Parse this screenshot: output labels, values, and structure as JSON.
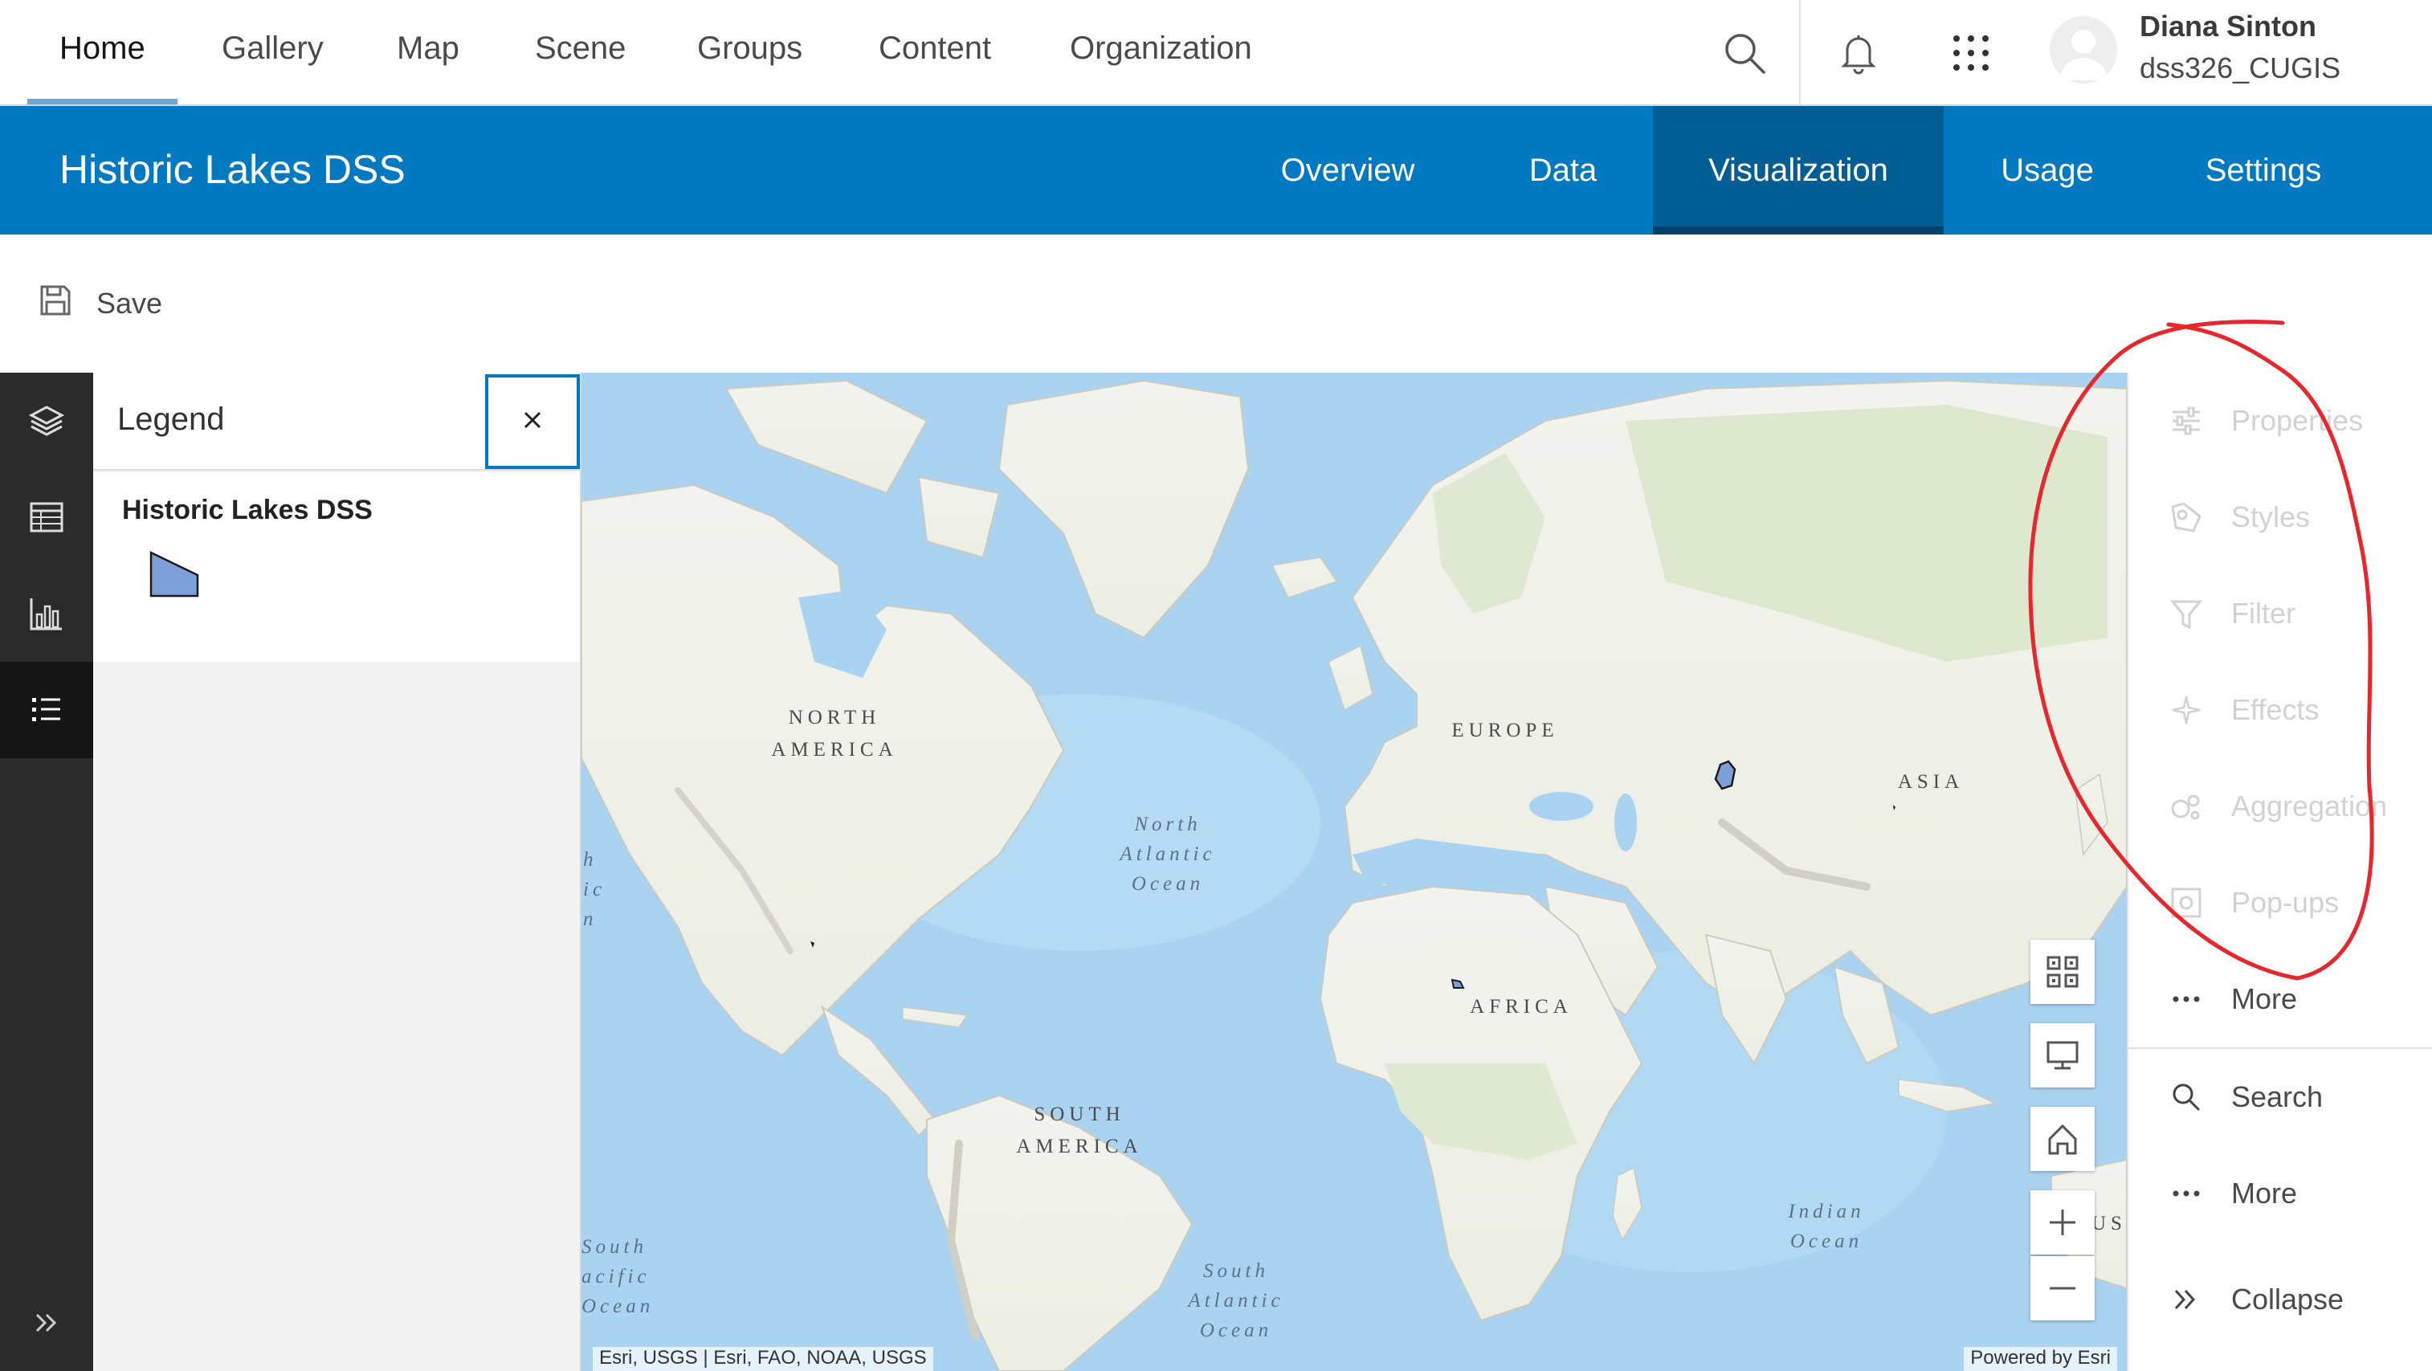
{
  "topnav": {
    "items": [
      {
        "label": "Home",
        "active": true
      },
      {
        "label": "Gallery"
      },
      {
        "label": "Map"
      },
      {
        "label": "Scene"
      },
      {
        "label": "Groups"
      },
      {
        "label": "Content"
      },
      {
        "label": "Organization"
      }
    ],
    "tools": [
      "search-icon",
      "bell-icon",
      "apps-grid-icon"
    ],
    "user": {
      "name": "Diana Sinton",
      "username": "dss326_CUGIS"
    }
  },
  "item_header": {
    "title": "Historic Lakes DSS",
    "tabs": [
      {
        "label": "Overview"
      },
      {
        "label": "Data"
      },
      {
        "label": "Visualization",
        "active": true
      },
      {
        "label": "Usage"
      },
      {
        "label": "Settings"
      }
    ]
  },
  "toolbar": {
    "save_label": "Save"
  },
  "action_bar": {
    "buttons": [
      "layers-icon",
      "table-icon",
      "chart-icon",
      "legend-list-icon"
    ],
    "active": "legend-list-icon",
    "expand_icon": "double-chevron-right-icon"
  },
  "legend": {
    "title": "Legend",
    "layers": [
      {
        "name": "Historic Lakes DSS",
        "symbol_color": "#7ea0d9"
      }
    ]
  },
  "map": {
    "continent_labels": [
      "NORTH\nAMERICA",
      "EUROPE",
      "ASIA",
      "AFRICA",
      "SOUTH\nAMERICA"
    ],
    "ocean_labels": [
      "North\nAtlantic\nOcean",
      "Indian\nOcean",
      "South\nAtlantic\nOcean",
      "South\nPacific\nOcean",
      "North\nPacific\nOcean"
    ],
    "partial_labels": {
      "pacific_south": "South\nacific\nOcean",
      "pacific_north": "h\nic\nn",
      "australia": "US"
    },
    "attribution": "Esri, USGS | Esri, FAO, NOAA, USGS",
    "powered_by": "Powered by Esri",
    "controls": [
      "qr-grid-icon",
      "monitor-icon",
      "home-icon",
      "zoom-in-icon",
      "zoom-out-icon"
    ]
  },
  "right_panel": {
    "layer_tools": [
      {
        "label": "Properties",
        "icon": "sliders-icon",
        "enabled": false
      },
      {
        "label": "Styles",
        "icon": "styles-icon",
        "enabled": false
      },
      {
        "label": "Filter",
        "icon": "filter-icon",
        "enabled": false
      },
      {
        "label": "Effects",
        "icon": "sparkle-icon",
        "enabled": false
      },
      {
        "label": "Aggregation",
        "icon": "aggregation-icon",
        "enabled": false
      },
      {
        "label": "Pop-ups",
        "icon": "popup-icon",
        "enabled": false
      },
      {
        "label": "More",
        "icon": "ellipsis-icon",
        "enabled": true
      }
    ],
    "map_tools": [
      {
        "label": "Search",
        "icon": "search-icon"
      },
      {
        "label": "More",
        "icon": "ellipsis-icon"
      }
    ],
    "collapse_label": "Collapse"
  },
  "colors": {
    "brand_blue": "#0079c1",
    "active_tab": "#005e95",
    "annotation_red": "#e8262c",
    "water": "#a9d3f1",
    "land": "#eef0e6"
  }
}
